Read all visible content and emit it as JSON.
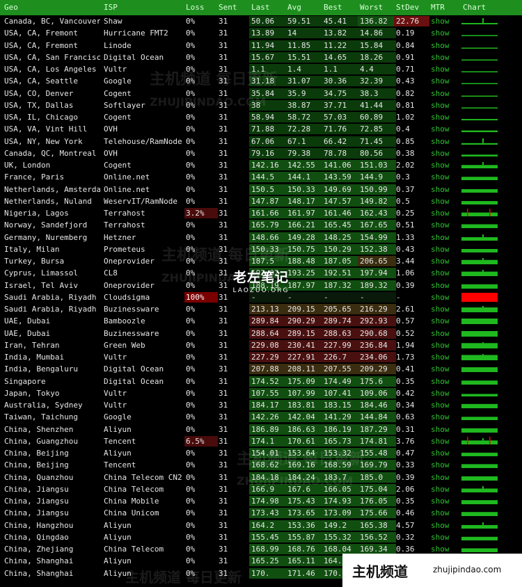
{
  "headers": [
    "Geo",
    "ISP",
    "Loss",
    "Sent",
    "Last",
    "Avg",
    "Best",
    "Worst",
    "StDev",
    "MTR",
    "Chart"
  ],
  "rows": [
    {
      "geo": "Canada, BC, Vancouver",
      "isp": "Shaw",
      "loss": "0%",
      "sent": "31",
      "last": "50.06",
      "avg": "59.51",
      "best": "45.41",
      "worst": "136.82",
      "stdev": "22.76",
      "mtr": "show"
    },
    {
      "geo": "USA, CA, Fremont",
      "isp": "Hurricane FMT2",
      "loss": "0%",
      "sent": "31",
      "last": "13.89",
      "avg": "14",
      "best": "13.82",
      "worst": "14.86",
      "stdev": "0.19",
      "mtr": "show"
    },
    {
      "geo": "USA, CA, Fremont",
      "isp": "Linode",
      "loss": "0%",
      "sent": "31",
      "last": "11.94",
      "avg": "11.85",
      "best": "11.22",
      "worst": "15.84",
      "stdev": "0.84",
      "mtr": "show"
    },
    {
      "geo": "USA, CA, San Francisco",
      "isp": "Digital Ocean",
      "loss": "0%",
      "sent": "31",
      "last": "15.67",
      "avg": "15.51",
      "best": "14.65",
      "worst": "18.26",
      "stdev": "0.91",
      "mtr": "show"
    },
    {
      "geo": "USA, CA, Los Angeles",
      "isp": "Vultr",
      "loss": "0%",
      "sent": "31",
      "last": "1.1",
      "avg": "1.4",
      "best": "1.1",
      "worst": "4.4",
      "stdev": "0.71",
      "mtr": "show"
    },
    {
      "geo": "USA, CA, Seattle",
      "isp": "Google",
      "loss": "0%",
      "sent": "31",
      "last": "31.18",
      "avg": "31.07",
      "best": "30.36",
      "worst": "32.39",
      "stdev": "0.43",
      "mtr": "show"
    },
    {
      "geo": "USA, CO, Denver",
      "isp": "Cogent",
      "loss": "0%",
      "sent": "31",
      "last": "35.84",
      "avg": "35.9",
      "best": "34.75",
      "worst": "38.3",
      "stdev": "0.82",
      "mtr": "show"
    },
    {
      "geo": "USA, TX, Dallas",
      "isp": "Softlayer",
      "loss": "0%",
      "sent": "31",
      "last": "38",
      "avg": "38.87",
      "best": "37.71",
      "worst": "41.44",
      "stdev": "0.81",
      "mtr": "show"
    },
    {
      "geo": "USA, IL, Chicago",
      "isp": "Cogent",
      "loss": "0%",
      "sent": "31",
      "last": "58.94",
      "avg": "58.72",
      "best": "57.03",
      "worst": "60.89",
      "stdev": "1.02",
      "mtr": "show"
    },
    {
      "geo": "USA, VA, Vint Hill",
      "isp": "OVH",
      "loss": "0%",
      "sent": "31",
      "last": "71.88",
      "avg": "72.28",
      "best": "71.76",
      "worst": "72.85",
      "stdev": "0.4",
      "mtr": "show"
    },
    {
      "geo": "USA, NY, New York",
      "isp": "Telehouse/RamNode",
      "loss": "0%",
      "sent": "31",
      "last": "67.06",
      "avg": "67.1",
      "best": "66.42",
      "worst": "71.45",
      "stdev": "0.85",
      "mtr": "show"
    },
    {
      "geo": "Canada, QC, Montreal",
      "isp": "OVH",
      "loss": "0%",
      "sent": "31",
      "last": "79.16",
      "avg": "79.38",
      "best": "78.78",
      "worst": "80.56",
      "stdev": "0.38",
      "mtr": "show"
    },
    {
      "geo": "UK, London",
      "isp": "Cogent",
      "loss": "0%",
      "sent": "31",
      "last": "142.16",
      "avg": "142.55",
      "best": "141.06",
      "worst": "151.03",
      "stdev": "2.02",
      "mtr": "show"
    },
    {
      "geo": "France, Paris",
      "isp": "Online.net",
      "loss": "0%",
      "sent": "31",
      "last": "144.5",
      "avg": "144.1",
      "best": "143.59",
      "worst": "144.9",
      "stdev": "0.3",
      "mtr": "show"
    },
    {
      "geo": "Netherlands, Amsterdam",
      "isp": "Online.net",
      "loss": "0%",
      "sent": "31",
      "last": "150.5",
      "avg": "150.33",
      "best": "149.69",
      "worst": "150.99",
      "stdev": "0.37",
      "mtr": "show"
    },
    {
      "geo": "Netherlands, Nuland",
      "isp": "WeservIT/RamNode",
      "loss": "0%",
      "sent": "31",
      "last": "147.87",
      "avg": "148.17",
      "best": "147.57",
      "worst": "149.82",
      "stdev": "0.5",
      "mtr": "show"
    },
    {
      "geo": "Nigeria, Lagos",
      "isp": "Terrahost",
      "loss": "3.2%",
      "sent": "31",
      "last": "161.66",
      "avg": "161.97",
      "best": "161.46",
      "worst": "162.43",
      "stdev": "0.25",
      "mtr": "show"
    },
    {
      "geo": "Norway, Sandefjord",
      "isp": "Terrahost",
      "loss": "0%",
      "sent": "31",
      "last": "165.79",
      "avg": "166.21",
      "best": "165.45",
      "worst": "167.65",
      "stdev": "0.51",
      "mtr": "show"
    },
    {
      "geo": "Germany, Nuremberg",
      "isp": "Hetzner",
      "loss": "0%",
      "sent": "31",
      "last": "148.66",
      "avg": "149.28",
      "best": "148.25",
      "worst": "154.99",
      "stdev": "1.33",
      "mtr": "show"
    },
    {
      "geo": "Italy, Milan",
      "isp": "Prometeus",
      "loss": "0%",
      "sent": "31",
      "last": "150.33",
      "avg": "150.75",
      "best": "150.29",
      "worst": "152.38",
      "stdev": "0.43",
      "mtr": "show"
    },
    {
      "geo": "Turkey, Bursa",
      "isp": "Oneprovider",
      "loss": "0%",
      "sent": "31",
      "last": "187.5",
      "avg": "188.48",
      "best": "187.05",
      "worst": "206.65",
      "stdev": "3.44",
      "mtr": "show"
    },
    {
      "geo": "Cyprus, Limassol",
      "isp": "CL8",
      "loss": "0%",
      "sent": "31",
      "last": "192.92",
      "avg": "193.25",
      "best": "192.51",
      "worst": "197.94",
      "stdev": "1.06",
      "mtr": "show"
    },
    {
      "geo": "Israel, Tel Aviv",
      "isp": "Oneprovider",
      "loss": "0%",
      "sent": "31",
      "last": "188.19",
      "avg": "187.97",
      "best": "187.32",
      "worst": "189.32",
      "stdev": "0.39",
      "mtr": "show"
    },
    {
      "geo": "Saudi Arabia, Riyadh",
      "isp": "Cloudsigma",
      "loss": "100%",
      "sent": "31",
      "last": "-",
      "avg": "-",
      "best": "-",
      "worst": "-",
      "stdev": "-",
      "mtr": "show"
    },
    {
      "geo": "Saudi Arabia, Riyadh",
      "isp": "Buzinessware",
      "loss": "0%",
      "sent": "31",
      "last": "213.13",
      "avg": "209.15",
      "best": "205.65",
      "worst": "216.29",
      "stdev": "2.61",
      "mtr": "show"
    },
    {
      "geo": "UAE, Dubai",
      "isp": "Bamboozle",
      "loss": "0%",
      "sent": "31",
      "last": "289.84",
      "avg": "290.29",
      "best": "289.74",
      "worst": "292.93",
      "stdev": "0.57",
      "mtr": "show"
    },
    {
      "geo": "UAE, Dubai",
      "isp": "Buzinessware",
      "loss": "0%",
      "sent": "31",
      "last": "288.64",
      "avg": "289.15",
      "best": "288.63",
      "worst": "290.68",
      "stdev": "0.52",
      "mtr": "show"
    },
    {
      "geo": "Iran, Tehran",
      "isp": "Green Web",
      "loss": "0%",
      "sent": "31",
      "last": "229.08",
      "avg": "230.41",
      "best": "227.99",
      "worst": "236.84",
      "stdev": "1.94",
      "mtr": "show"
    },
    {
      "geo": "India, Mumbai",
      "isp": "Vultr",
      "loss": "0%",
      "sent": "31",
      "last": "227.29",
      "avg": "227.91",
      "best": "226.7",
      "worst": "234.06",
      "stdev": "1.73",
      "mtr": "show"
    },
    {
      "geo": "India, Bengaluru",
      "isp": "Digital Ocean",
      "loss": "0%",
      "sent": "31",
      "last": "207.88",
      "avg": "208.11",
      "best": "207.55",
      "worst": "209.29",
      "stdev": "0.41",
      "mtr": "show"
    },
    {
      "geo": "Singapore",
      "isp": "Digital Ocean",
      "loss": "0%",
      "sent": "31",
      "last": "174.52",
      "avg": "175.09",
      "best": "174.49",
      "worst": "175.6",
      "stdev": "0.35",
      "mtr": "show"
    },
    {
      "geo": "Japan, Tokyo",
      "isp": "Vultr",
      "loss": "0%",
      "sent": "31",
      "last": "107.55",
      "avg": "107.99",
      "best": "107.41",
      "worst": "109.06",
      "stdev": "0.42",
      "mtr": "show"
    },
    {
      "geo": "Australia, Sydney",
      "isp": "Vultr",
      "loss": "0%",
      "sent": "31",
      "last": "184.17",
      "avg": "183.81",
      "best": "183.15",
      "worst": "184.46",
      "stdev": "0.34",
      "mtr": "show"
    },
    {
      "geo": "Taiwan, Taichung",
      "isp": "Google",
      "loss": "0%",
      "sent": "31",
      "last": "142.26",
      "avg": "142.04",
      "best": "141.29",
      "worst": "144.84",
      "stdev": "0.63",
      "mtr": "show"
    },
    {
      "geo": "China, Shenzhen",
      "isp": "Aliyun",
      "loss": "0%",
      "sent": "31",
      "last": "186.89",
      "avg": "186.63",
      "best": "186.19",
      "worst": "187.29",
      "stdev": "0.31",
      "mtr": "show"
    },
    {
      "geo": "China, Guangzhou",
      "isp": "Tencent",
      "loss": "6.5%",
      "sent": "31",
      "last": "174.1",
      "avg": "170.61",
      "best": "165.73",
      "worst": "174.81",
      "stdev": "3.76",
      "mtr": "show"
    },
    {
      "geo": "China, Beijing",
      "isp": "Aliyun",
      "loss": "0%",
      "sent": "31",
      "last": "154.01",
      "avg": "153.64",
      "best": "153.32",
      "worst": "155.48",
      "stdev": "0.47",
      "mtr": "show"
    },
    {
      "geo": "China, Beijing",
      "isp": "Tencent",
      "loss": "0%",
      "sent": "31",
      "last": "168.62",
      "avg": "169.16",
      "best": "168.59",
      "worst": "169.79",
      "stdev": "0.33",
      "mtr": "show"
    },
    {
      "geo": "China, Quanzhou",
      "isp": "China Telecom CN2",
      "loss": "0%",
      "sent": "31",
      "last": "184.18",
      "avg": "184.24",
      "best": "183.7",
      "worst": "185.0",
      "stdev": "0.39",
      "mtr": "show"
    },
    {
      "geo": "China, Jiangsu",
      "isp": "China Telecom",
      "loss": "0%",
      "sent": "31",
      "last": "166.9",
      "avg": "167.6",
      "best": "166.05",
      "worst": "175.04",
      "stdev": "2.06",
      "mtr": "show"
    },
    {
      "geo": "China, Jiangsu",
      "isp": "China Mobile",
      "loss": "0%",
      "sent": "31",
      "last": "174.98",
      "avg": "175.43",
      "best": "174.93",
      "worst": "176.05",
      "stdev": "0.35",
      "mtr": "show"
    },
    {
      "geo": "China, Jiangsu",
      "isp": "China Unicom",
      "loss": "0%",
      "sent": "31",
      "last": "173.43",
      "avg": "173.65",
      "best": "173.09",
      "worst": "175.66",
      "stdev": "0.46",
      "mtr": "show"
    },
    {
      "geo": "China, Hangzhou",
      "isp": "Aliyun",
      "loss": "0%",
      "sent": "31",
      "last": "164.2",
      "avg": "153.36",
      "best": "149.2",
      "worst": "165.38",
      "stdev": "4.57",
      "mtr": "show"
    },
    {
      "geo": "China, Qingdao",
      "isp": "Aliyun",
      "loss": "0%",
      "sent": "31",
      "last": "155.45",
      "avg": "155.87",
      "best": "155.32",
      "worst": "156.52",
      "stdev": "0.32",
      "mtr": "show"
    },
    {
      "geo": "China, Zhejiang",
      "isp": "China Telecom",
      "loss": "0%",
      "sent": "31",
      "last": "168.99",
      "avg": "168.76",
      "best": "168.04",
      "worst": "169.34",
      "stdev": "0.36",
      "mtr": "show"
    },
    {
      "geo": "China, Shanghai",
      "isp": "Aliyun",
      "loss": "0%",
      "sent": "31",
      "last": "165.25",
      "avg": "165.11",
      "best": "164.",
      "worst": "",
      "stdev": "",
      "mtr": "show"
    },
    {
      "geo": "China, Shanghai",
      "isp": "Aliyun",
      "loss": "0%",
      "sent": "31",
      "last": "170.",
      "avg": "171.46",
      "best": "170.",
      "worst": "",
      "stdev": "",
      "mtr": "show"
    }
  ],
  "watermark": {
    "zh": "主机频道 每日更新",
    "en": "ZHUJIPINDAO.COM"
  },
  "logo": {
    "title": "老左笔记",
    "sub": "LAOZUO.ORG"
  },
  "brand": {
    "zh": "主机频道",
    "url": "zhujipindao.com"
  },
  "colors": {
    "header": "#1e8f1e",
    "spark": "#1fb81f",
    "loss": "#ff0000"
  }
}
